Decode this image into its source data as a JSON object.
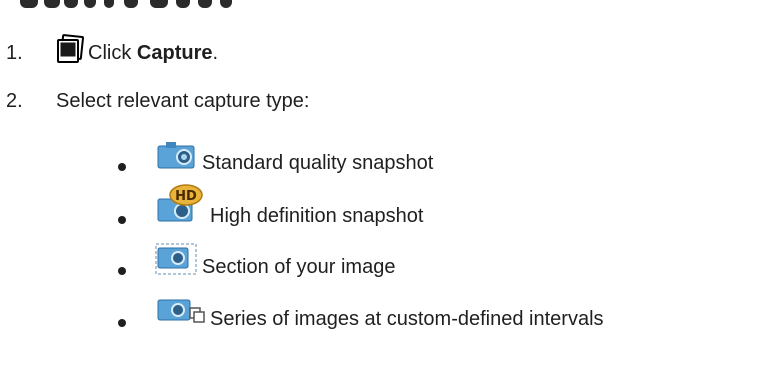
{
  "steps": [
    {
      "number": "1.",
      "prefix": "Click ",
      "bold": "Capture",
      "suffix": "."
    },
    {
      "number": "2.",
      "text": "Select relevant capture type:"
    }
  ],
  "capture_types": [
    {
      "label": "Standard quality snapshot",
      "icon": "camera-icon"
    },
    {
      "label": "High definition snapshot",
      "icon": "camera-hd-icon",
      "badge": "HD"
    },
    {
      "label": "Section of your image",
      "icon": "camera-section-icon"
    },
    {
      "label": "Series of images at custom-defined intervals",
      "icon": "camera-series-icon"
    }
  ],
  "colors": {
    "text": "#1f1f1f",
    "camera_blue": "#5aa3d8",
    "hd_gold": "#e8b43a"
  }
}
